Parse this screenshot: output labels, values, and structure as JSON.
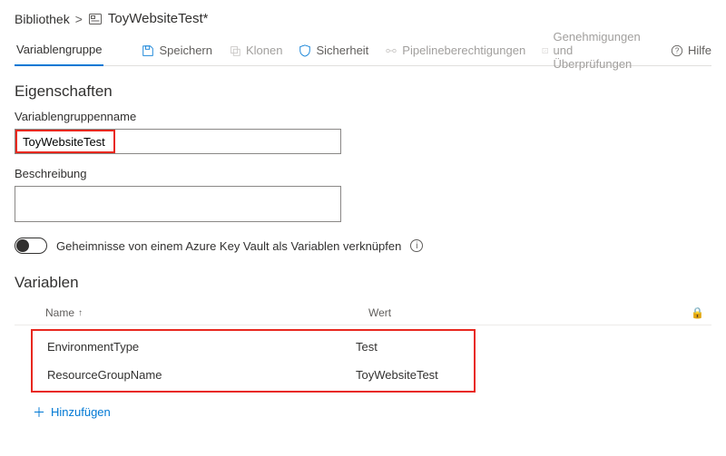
{
  "breadcrumb": {
    "root": "Bibliothek",
    "current": "ToyWebsiteTest*"
  },
  "toolbar": {
    "tab_variable_group": "Variablengruppe",
    "save": "Speichern",
    "clone": "Klonen",
    "security": "Sicherheit",
    "pipeline_permissions": "Pipelineberechtigungen",
    "approvals_checks": "Genehmigungen und Überprüfungen",
    "help": "Hilfe"
  },
  "properties": {
    "heading": "Eigenschaften",
    "name_label": "Variablengruppenname",
    "name_value": "ToyWebsiteTest",
    "description_label": "Beschreibung",
    "description_value": "",
    "keyvault_toggle_label": "Geheimnisse von einem Azure Key Vault als Variablen verknüpfen",
    "keyvault_toggle_on": false
  },
  "variables": {
    "heading": "Variablen",
    "col_name": "Name",
    "col_value": "Wert",
    "rows": [
      {
        "name": "EnvironmentType",
        "value": "Test"
      },
      {
        "name": "ResourceGroupName",
        "value": "ToyWebsiteTest"
      }
    ],
    "add_label": "Hinzufügen"
  }
}
